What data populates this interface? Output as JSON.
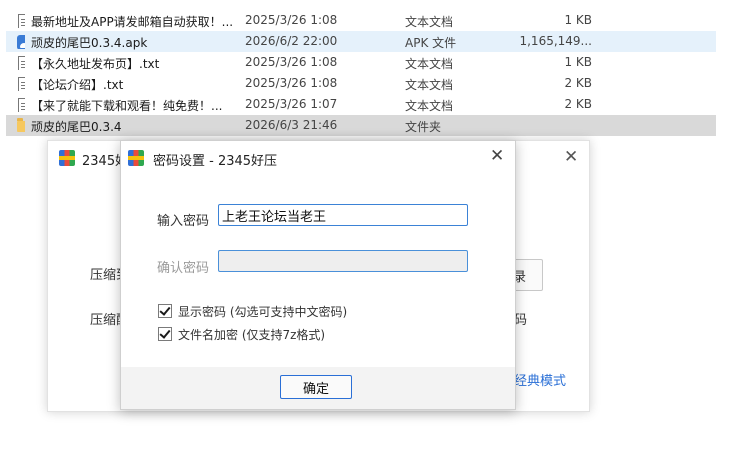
{
  "files": [
    {
      "name": "最新地址及APP请发邮箱自动获取！...",
      "date": "2025/3/26 1:08",
      "type": "文本文档",
      "size": "1 KB",
      "icon": "text-file-icon"
    },
    {
      "name": "顽皮的尾巴0.3.4.apk",
      "date": "2026/6/2 22:00",
      "type": "APK 文件",
      "size": "1,165,149...",
      "icon": "apk-file-icon"
    },
    {
      "name": "【永久地址发布页】.txt",
      "date": "2025/3/26 1:08",
      "type": "文本文档",
      "size": "1 KB",
      "icon": "text-file-icon"
    },
    {
      "name": "【论坛介绍】.txt",
      "date": "2025/3/26 1:08",
      "type": "文本文档",
      "size": "2 KB",
      "icon": "text-file-icon"
    },
    {
      "name": "【来了就能下载和观看！纯免费！...",
      "date": "2025/3/26 1:07",
      "type": "文本文档",
      "size": "2 KB",
      "icon": "text-file-icon"
    },
    {
      "name": "顽皮的尾巴0.3.4",
      "date": "2026/6/3 21:46",
      "type": "文件夹",
      "size": "",
      "icon": "folder-icon"
    }
  ],
  "back_window": {
    "title": "2345好",
    "close": "✕",
    "label_1": "压缩到",
    "label_2": "压缩配",
    "button_fragment": "录",
    "fragment_2": "码",
    "mode_link": "经典模式"
  },
  "dialog": {
    "title": "密码设置 - 2345好压",
    "close": "✕",
    "password_label": "输入密码",
    "password_value": "上老王论坛当老王",
    "confirm_label": "确认密码",
    "confirm_value": "",
    "show_password_label": "显示密码 (勾选可支持中文密码)",
    "encrypt_names_label": "文件名加密  (仅支持7z格式)",
    "ok_label": "确定"
  },
  "colors": {
    "accent": "#2a6fd6",
    "selection_light": "#e5f1fb",
    "selection_gray": "#d9d9d9"
  }
}
